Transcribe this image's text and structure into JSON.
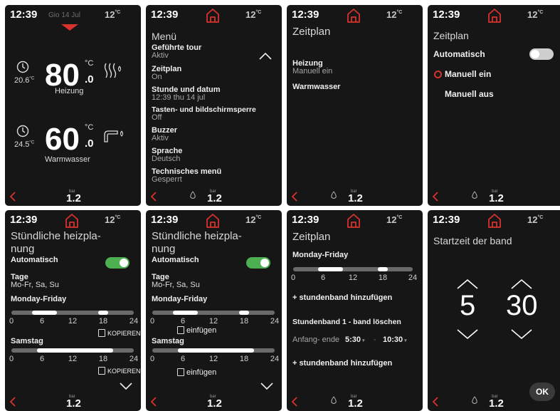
{
  "colors": {
    "accent": "#d8322e",
    "toggle_on": "#4caf50",
    "toggle_off": "#cfcfcf",
    "background": "#161616"
  },
  "status": {
    "time": "12:39",
    "date": "Gio 14 Jul",
    "temp": "12",
    "temp_unit": "°C"
  },
  "pressure": {
    "unit": "bar",
    "value": "1.2"
  },
  "icons": {
    "back": "chevron-left-icon",
    "home": "home-icon",
    "flame": "flame-icon",
    "clock": "clock-icon",
    "radiator": "radiator-icon",
    "tap": "faucet-icon",
    "copy": "copy-icon"
  },
  "screen1": {
    "heating": {
      "room_temp": "20.6",
      "room_unit": "°C",
      "set_value": "80",
      "set_decimal": ".0",
      "unit": "°C",
      "label": "Heizung"
    },
    "water": {
      "room_temp": "24.5",
      "room_unit": "°C",
      "set_value": "60",
      "set_decimal": ".0",
      "unit": "°C",
      "label": "Warmwasser"
    }
  },
  "screen2": {
    "title": "Menü",
    "items": [
      {
        "label": "Geführte tour",
        "value": "Aktiv"
      },
      {
        "label": "Zeitplan",
        "value": "On"
      },
      {
        "label": "Stunde und datum",
        "value": "12:39 thu 14 jul"
      },
      {
        "label": "Tasten- und bildschirmsperre",
        "value": "Off"
      },
      {
        "label": "Buzzer",
        "value": "Aktiv"
      },
      {
        "label": "Sprache",
        "value": "Deutsch"
      },
      {
        "label": "Technisches menü",
        "value": "Gesperrt"
      }
    ]
  },
  "screen3": {
    "title": "Zeitplan",
    "item1_label": "Heizung",
    "item1_value": "Manuell ein",
    "item2_label": "Warmwasser"
  },
  "screen4": {
    "title": "Zeitplan",
    "auto_label": "Automatisch",
    "auto_state": false,
    "option1": "Manuell ein",
    "option2": "Manuell aus",
    "selected": "Manuell ein"
  },
  "screen5": {
    "title_line1": "Stündliche heizpla-",
    "title_line2": "nung",
    "auto_label": "Automatisch",
    "auto_state": true,
    "days_label": "Tage",
    "days_value": "Mo-Fr, Sa, Su",
    "group1": "Monday-Friday",
    "group2": "Samstag",
    "ticks": [
      "0",
      "6",
      "12",
      "18",
      "24"
    ],
    "copy_label": "KOPIEREN",
    "bands1": [
      [
        4,
        9
      ],
      [
        17,
        19
      ]
    ],
    "bands2": [
      [
        5,
        20
      ]
    ]
  },
  "screen6": {
    "title_line1": "Stündliche heizpla-",
    "title_line2": "nung",
    "auto_label": "Automatisch",
    "auto_state": true,
    "days_label": "Tage",
    "days_value": "Mo-Fr, Sa, Su",
    "group1": "Monday-Friday",
    "group2": "Samstag",
    "ticks": [
      "0",
      "6",
      "12",
      "18",
      "24"
    ],
    "paste_label": "einfügen",
    "bands1": [
      [
        4,
        9
      ],
      [
        17,
        19
      ]
    ],
    "bands2": [
      [
        5,
        20
      ]
    ]
  },
  "screen7": {
    "title": "Zeitplan",
    "group": "Monday-Friday",
    "ticks": [
      "0",
      "6",
      "12",
      "18",
      "24"
    ],
    "bands": [
      [
        5,
        10
      ],
      [
        17,
        19
      ]
    ],
    "add_band_1": "+ stundenband hinzufügen",
    "band_title": "Stundenband 1 - band löschen",
    "range_label": "Anfang- ende",
    "start": "5:30",
    "sep": "-",
    "end": "10:30",
    "add_band_2": "+ stundenband hinzufügen"
  },
  "screen8": {
    "title": "Startzeit der band",
    "hour": "5",
    "minute": "30",
    "ok": "OK"
  }
}
